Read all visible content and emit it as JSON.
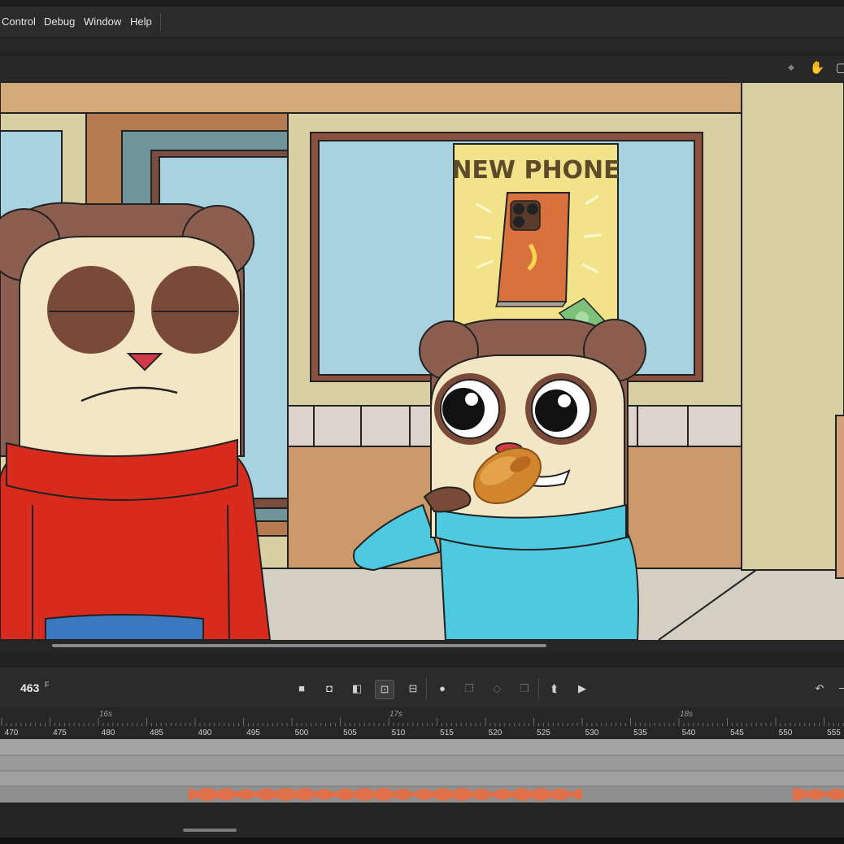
{
  "menu": {
    "items": [
      {
        "label": "Control"
      },
      {
        "label": "Debug"
      },
      {
        "label": "Window"
      },
      {
        "label": "Help"
      }
    ]
  },
  "toolbar_icons": [
    "snap-icon",
    "hand-icon",
    "stage-size-icon"
  ],
  "stage": {
    "poster_text": "NEW PHONE",
    "colors": {
      "red_sweater": "#d92b1d",
      "blue_sweater": "#4fc9e0",
      "fur": "#8b5e4f",
      "face": "#f2e6c4",
      "sky_window": "#a8d2df",
      "poster": "#f2e38a",
      "phone": "#d9713f",
      "wall": "#d8cfa2",
      "top_trim": "#d4a97a"
    }
  },
  "timeline": {
    "current_frame": "463",
    "frame_suffix": "F",
    "seconds_labels": [
      "16s",
      "17s",
      "18s"
    ],
    "frame_labels": [
      "470",
      "475",
      "480",
      "485",
      "490",
      "495",
      "500",
      "505",
      "510",
      "515",
      "520",
      "525",
      "530",
      "535",
      "540",
      "545",
      "550",
      "555"
    ],
    "controls": [
      {
        "name": "insert-keyframe-icon",
        "dim": false
      },
      {
        "name": "insert-blank-keyframe-icon",
        "dim": false
      },
      {
        "name": "insert-frame-icon",
        "dim": false
      },
      {
        "name": "auto-keyframe-icon",
        "dim": false,
        "active": true
      },
      {
        "name": "delete-frame-icon",
        "dim": false
      },
      {
        "name": "onion-skin-icon",
        "dim": false
      },
      {
        "name": "onion-outline-icon",
        "dim": true
      },
      {
        "name": "edit-multiple-frames-icon",
        "dim": true
      },
      {
        "name": "onion-range-icon",
        "dim": true
      },
      {
        "name": "loop-icon",
        "dim": false
      },
      {
        "name": "play-icon",
        "dim": false
      }
    ],
    "audio_color": "#e0704a"
  }
}
